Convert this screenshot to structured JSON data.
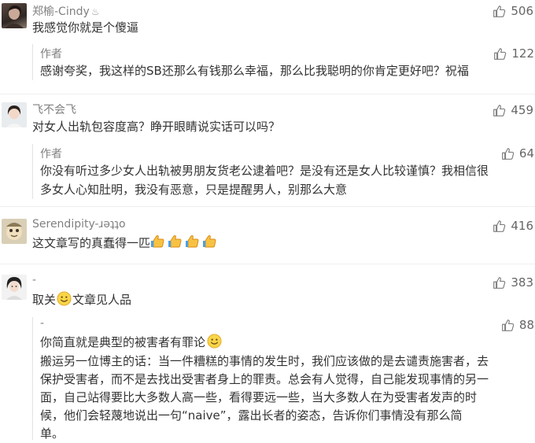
{
  "comments": [
    {
      "username": "郑榆-Cindy",
      "likes": "506",
      "text": "我感觉你就是个傻逼",
      "reply": {
        "author": "作者",
        "likes": "122",
        "lines": [
          "感谢夸奖，我这样的SB还那么有钱那么幸福，那么比我聪明的你肯定更好吧？祝福"
        ]
      }
    },
    {
      "username": "飞不会飞",
      "likes": "459",
      "text": "对女人出轨包容度高？睁开眼睛说实话可以吗？",
      "reply": {
        "author": "作者",
        "likes": "64",
        "lines": [
          "你没有听过多少女人出轨被男朋友货老公逮着吧？是没有还是女人比较谨慎？我相信很",
          "多女人心知肚明，我没有恶意，只是提醒男人，别那么大意"
        ]
      }
    },
    {
      "username": "Serendipity-ɹəʇʇo",
      "likes": "416",
      "text": "这文章写的真蠢得一匹"
    },
    {
      "username": "-",
      "likes": "383",
      "text_before": "取关",
      "text_after": "文章见人品",
      "reply": {
        "author": "-",
        "likes": "88",
        "line1": "你简直就是典型的被害者有罪论",
        "lines": [
          "搬运另一位博主的话：当一件糟糕的事情的发生时，我们应该做的是去谴责施害者，去",
          "保护受害者，而不是去找出受害者身上的罪责。总会有人觉得，自己能发现事情的另一",
          "面，自己站得要比大多数人高一些，看得要远一些，当大多数人在为受害者发声的时",
          "候，他们会轻蔑地说出一句“naive”，露出长者的姿态，告诉你们事情没有那么简",
          "单。"
        ]
      }
    }
  ],
  "colors": {
    "name": "#808080",
    "text": "#333333",
    "likes": "#666666",
    "divider": "#f0f0f0"
  }
}
